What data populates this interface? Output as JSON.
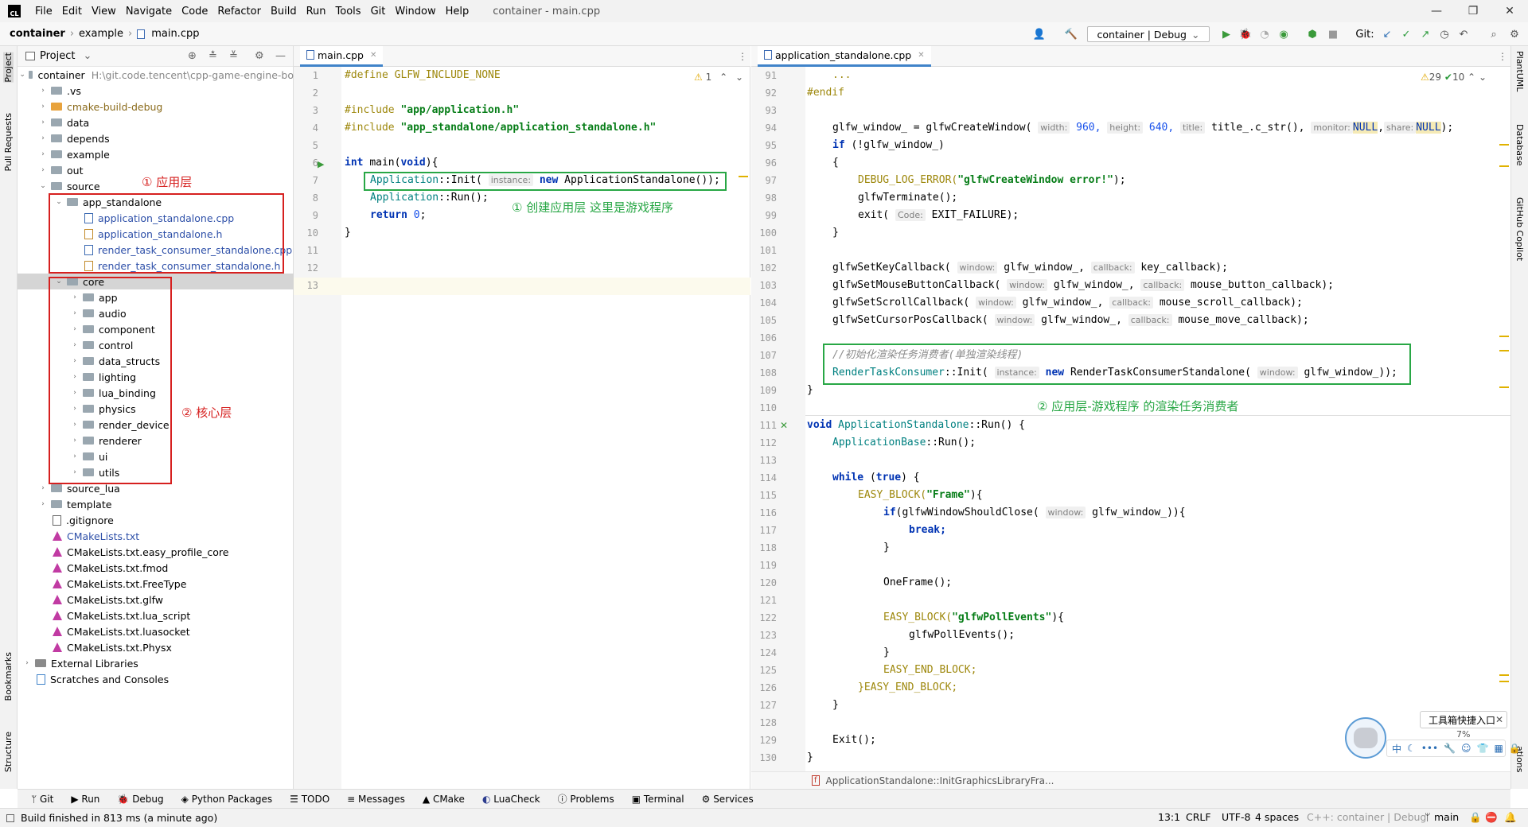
{
  "app": {
    "logo": "CL",
    "window_title": "container - main.cpp"
  },
  "menu": [
    "File",
    "Edit",
    "View",
    "Navigate",
    "Code",
    "Refactor",
    "Build",
    "Run",
    "Tools",
    "Git",
    "Window",
    "Help"
  ],
  "window_controls": {
    "minimize": "—",
    "maximize": "❐",
    "close": "✕"
  },
  "breadcrumb": {
    "root": "container",
    "folder": "example",
    "file": "main.cpp"
  },
  "toolbar": {
    "run_config": "container | Debug",
    "git_label": "Git:"
  },
  "left_strip": {
    "project": "Project",
    "pull_requests": "Pull Requests",
    "bookmarks": "Bookmarks",
    "structure": "Structure"
  },
  "right_strip": {
    "plantuml": "PlantUML",
    "database": "Database",
    "copilot": "GitHub Copilot",
    "notifications": "ations"
  },
  "project_panel": {
    "title": "Project",
    "root": {
      "name": "container",
      "path": "H:\\git.code.tencent\\cpp-game-engine-bo"
    },
    "items": [
      {
        "label": ".vs"
      },
      {
        "label": "cmake-build-debug"
      },
      {
        "label": "data"
      },
      {
        "label": "depends"
      },
      {
        "label": "example"
      },
      {
        "label": "out"
      },
      {
        "label": "source"
      },
      {
        "label": "app_standalone"
      },
      {
        "label": "application_standalone.cpp"
      },
      {
        "label": "application_standalone.h"
      },
      {
        "label": "render_task_consumer_standalone.cpp"
      },
      {
        "label": "render_task_consumer_standalone.h"
      },
      {
        "label": "core"
      },
      {
        "label": "app"
      },
      {
        "label": "audio"
      },
      {
        "label": "component"
      },
      {
        "label": "control"
      },
      {
        "label": "data_structs"
      },
      {
        "label": "lighting"
      },
      {
        "label": "lua_binding"
      },
      {
        "label": "physics"
      },
      {
        "label": "render_device"
      },
      {
        "label": "renderer"
      },
      {
        "label": "ui"
      },
      {
        "label": "utils"
      },
      {
        "label": "source_lua"
      },
      {
        "label": "template"
      },
      {
        "label": ".gitignore"
      },
      {
        "label": "CMakeLists.txt"
      },
      {
        "label": "CMakeLists.txt.easy_profile_core"
      },
      {
        "label": "CMakeLists.txt.fmod"
      },
      {
        "label": "CMakeLists.txt.FreeType"
      },
      {
        "label": "CMakeLists.txt.glfw"
      },
      {
        "label": "CMakeLists.txt.lua_script"
      },
      {
        "label": "CMakeLists.txt.luasocket"
      },
      {
        "label": "CMakeLists.txt.Physx"
      },
      {
        "label": "External Libraries"
      },
      {
        "label": "Scratches and Consoles"
      }
    ],
    "annotation_app_layer": "① 应用层",
    "annotation_core_layer": "② 核心层"
  },
  "editor_left": {
    "tab": "main.cpp",
    "warnings": "1",
    "line_numbers": [
      "1",
      "2",
      "3",
      "4",
      "5",
      "6",
      "7",
      "8",
      "9",
      "10",
      "11",
      "12",
      "13"
    ],
    "lines": {
      "l1a": "#define ",
      "l1b": "GLFW_INCLUDE_NONE",
      "l3a": "#include ",
      "l3b": "\"app/application.h\"",
      "l4a": "#include ",
      "l4b": "\"app_standalone/application_standalone.h\"",
      "l6a": "int ",
      "l6b": "main(",
      "l6c": "void",
      "l6d": "){",
      "l7a": "Application",
      "l7b": "::Init( ",
      "l7h": "instance:",
      "l7c": " new ",
      "l7d": "ApplicationStandalone());",
      "l8a": "Application",
      "l8b": "::Run();",
      "l9a": "return ",
      "l9b": "0",
      ";": ";",
      "l10": "}"
    },
    "annotation": "① 创建应用层 这里是游戏程序"
  },
  "editor_right": {
    "tab": "application_standalone.cpp",
    "warnings": "29",
    "checks": "10",
    "line_numbers": [
      "91",
      "92",
      "93",
      "94",
      "95",
      "96",
      "97",
      "98",
      "99",
      "100",
      "101",
      "102",
      "103",
      "104",
      "105",
      "106",
      "107",
      "108",
      "109",
      "110",
      "111",
      "112",
      "113",
      "114",
      "115",
      "116",
      "117",
      "118",
      "119",
      "120",
      "121",
      "122",
      "123",
      "124",
      "125",
      "126",
      "127",
      "128",
      "129",
      "130"
    ],
    "lines": {
      "l91": "...",
      "l92": "#endif",
      "l94a": "glfw_window_ = glfwCreateWindow( ",
      "l94h1": "width:",
      "l94b": " 960, ",
      "l94h2": "height:",
      "l94c": " 640, ",
      "l94h3": "title:",
      "l94d": " title_.c_str(), ",
      "l94h4": "monitor:",
      "l94e": "NULL",
      ",": ",",
      "l94h5": "share:",
      "l94f": "NULL",
      ");": ");",
      "l95a": "if ",
      "l95b": "(!glfw_window_)",
      "l96": "{",
      "l97a": "DEBUG_LOG_ERROR(",
      "l97b": "\"glfwCreateWindow error!\"",
      "l97c": ");",
      "l98": "glfwTerminate();",
      "l99a": "exit( ",
      "l99h": "Code:",
      "l99b": " EXIT_FAILURE);",
      "l100": "}",
      "l102a": "glfwSetKeyCallback( ",
      "l102h1": "window:",
      "l102b": " glfw_window_, ",
      "l102h2": "callback:",
      "l102c": " key_callback);",
      "l103a": "glfwSetMouseButtonCallback( ",
      "l103h1": "window:",
      "l103b": " glfw_window_, ",
      "l103h2": "callback:",
      "l103c": " mouse_button_callback);",
      "l104a": "glfwSetScrollCallback( ",
      "l104h1": "window:",
      "l104b": " glfw_window_, ",
      "l104h2": "callback:",
      "l104c": " mouse_scroll_callback);",
      "l105a": "glfwSetCursorPosCallback( ",
      "l105h1": "window:",
      "l105b": " glfw_window_, ",
      "l105h2": "callback:",
      "l105c": " mouse_move_callback);",
      "l107": "//初始化渲染任务消费者(单独渲染线程)",
      "l108a": "RenderTaskConsumer",
      "l108b": "::Init( ",
      "l108h1": "instance:",
      "l108c": " new ",
      "l108d": "RenderTaskConsumerStandalone( ",
      "l108h2": "window:",
      "l108e": " glfw_window_));",
      "l109": "}",
      "l111a": "void ",
      "l111b": "ApplicationStandalone",
      "l111c": "::Run() {",
      "l112a": "ApplicationBase",
      "l112b": "::Run();",
      "l114a": "while ",
      "l114b": "(",
      "l114c": "true",
      "l114d": ") {",
      "l115a": "EASY_BLOCK(",
      "l115b": "\"Frame\"",
      "l115c": "){",
      "l116a": "if",
      "l116b": "(glfwWindowShouldClose( ",
      "l116h": "window:",
      "l116c": " glfw_window_)){",
      "l117": "break;",
      "l118": "}",
      "l120": "OneFrame();",
      "l122a": "EASY_BLOCK(",
      "l122b": "\"glfwPollEvents\"",
      "l122c": "){",
      "l123": "glfwPollEvents();",
      "l124": "}",
      "l125": "EASY_END_BLOCK;",
      "l126": "}EASY_END_BLOCK;",
      "l127": "}",
      "l129": "Exit();",
      "l130": "}"
    },
    "annotation": "② 应用层-游戏程序 的渲染任务消费者",
    "breadcrumb": "ApplicationStandalone::InitGraphicsLibraryFra..."
  },
  "floating": {
    "toolbox": "工具箱快捷入口",
    "percent": "7%",
    "ime": "中"
  },
  "tool_windows": [
    "Git",
    "Run",
    "Debug",
    "Python Packages",
    "TODO",
    "Messages",
    "CMake",
    "LuaCheck",
    "Problems",
    "Terminal",
    "Services"
  ],
  "status": {
    "message": "Build finished in 813 ms (a minute ago)",
    "position": "13:1",
    "line_ending": "CRLF",
    "encoding": "UTF-8",
    "indent": "4 spaces",
    "context": "C++: container | Debug",
    "branch": "main"
  }
}
